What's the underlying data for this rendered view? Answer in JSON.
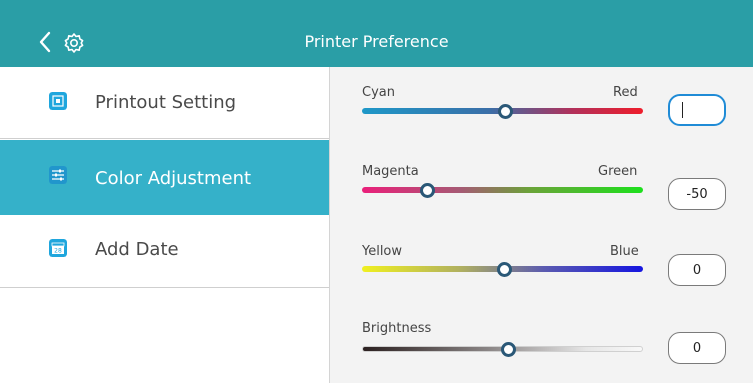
{
  "header": {
    "title": "Printer Preference"
  },
  "sidebar": {
    "items": [
      {
        "label": "Printout Setting",
        "icon": "printout-icon",
        "active": false
      },
      {
        "label": "Color Adjustment",
        "icon": "sliders-icon",
        "active": true
      },
      {
        "label": "Add Date",
        "icon": "calendar-icon",
        "icon_text": "28",
        "active": false
      }
    ]
  },
  "adjustments": {
    "cyan_red": {
      "left_label": "Cyan",
      "right_label": "Red",
      "value": "",
      "position": 0.5
    },
    "magenta_green": {
      "left_label": "Magenta",
      "right_label": "Green",
      "value": "-50",
      "position": 0.23
    },
    "yellow_blue": {
      "left_label": "Yellow",
      "right_label": "Blue",
      "value": "0",
      "position": 0.5
    },
    "brightness": {
      "label": "Brightness",
      "value": "0",
      "position": 0.52
    }
  },
  "colors": {
    "header": "#2a9ea6",
    "active_item": "#35b1c9",
    "focus_border": "#1f8bd6"
  }
}
